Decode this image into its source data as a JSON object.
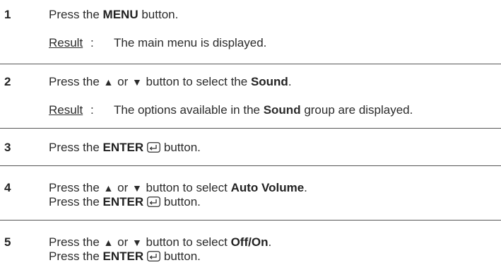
{
  "steps": [
    {
      "number": "1",
      "line1": {
        "pre": "Press the ",
        "bold": "MENU",
        "post": " button."
      },
      "result": {
        "label": "Result",
        "colon": ":",
        "text": "The main menu is displayed."
      }
    },
    {
      "number": "2",
      "line1": {
        "pre": "Press the ",
        "up": "▲",
        "or": " or ",
        "down": "▼",
        "mid": " button to select the ",
        "bold": "Sound",
        "post": "."
      },
      "result": {
        "label": "Result",
        "colon": ":",
        "pre": "The options available in the ",
        "bold": "Sound",
        "post": " group are displayed."
      }
    },
    {
      "number": "3",
      "line1": {
        "pre": "Press the ",
        "bold": "ENTER",
        "post": " button."
      }
    },
    {
      "number": "4",
      "line1": {
        "pre": "Press the ",
        "up": "▲",
        "or": " or ",
        "down": "▼",
        "mid": " button to select ",
        "bold": "Auto Volume",
        "post": "."
      },
      "line2": {
        "pre": "Press the ",
        "bold": "ENTER",
        "post": " button."
      }
    },
    {
      "number": "5",
      "line1": {
        "pre": "Press the ",
        "up": "▲",
        "or": " or ",
        "down": "▼",
        "mid": " button to select ",
        "bold": "Off/On",
        "post": "."
      },
      "line2": {
        "pre": "Press the ",
        "bold": "ENTER",
        "post": " button."
      }
    }
  ],
  "icons": {
    "enter": "enter-key-icon",
    "up": "up-triangle-icon",
    "down": "down-triangle-icon"
  }
}
